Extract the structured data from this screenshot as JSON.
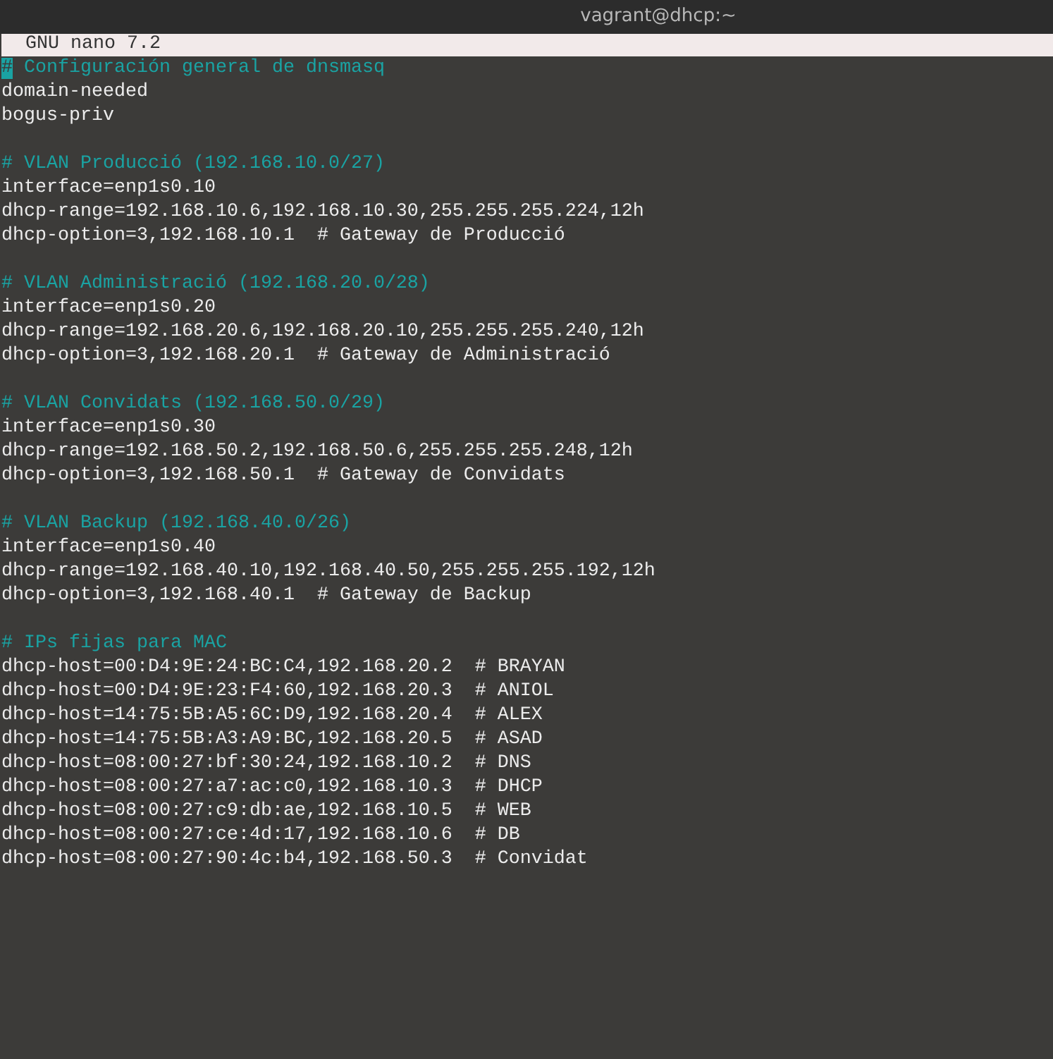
{
  "window": {
    "title": "vagrant@dhcp:~"
  },
  "editor": {
    "header": "GNU nano 7.2",
    "lines": [
      {
        "kind": "comment",
        "text": "# Configuración general de dnsmasq",
        "cursor": true
      },
      {
        "kind": "code",
        "text": "domain-needed",
        "cursor": false
      },
      {
        "kind": "code",
        "text": "bogus-priv",
        "cursor": false
      },
      {
        "kind": "blank",
        "cursor": false
      },
      {
        "kind": "comment",
        "text": "# VLAN Producció (192.168.10.0/27)",
        "cursor": false
      },
      {
        "kind": "code",
        "text": "interface=enp1s0.10",
        "cursor": false
      },
      {
        "kind": "code",
        "text": "dhcp-range=192.168.10.6,192.168.10.30,255.255.255.224,12h",
        "cursor": false
      },
      {
        "kind": "code",
        "text": "dhcp-option=3,192.168.10.1  # Gateway de Producció",
        "cursor": false
      },
      {
        "kind": "blank",
        "cursor": false
      },
      {
        "kind": "comment",
        "text": "# VLAN Administració (192.168.20.0/28)",
        "cursor": false
      },
      {
        "kind": "code",
        "text": "interface=enp1s0.20",
        "cursor": false
      },
      {
        "kind": "code",
        "text": "dhcp-range=192.168.20.6,192.168.20.10,255.255.255.240,12h",
        "cursor": false
      },
      {
        "kind": "code",
        "text": "dhcp-option=3,192.168.20.1  # Gateway de Administració",
        "cursor": false
      },
      {
        "kind": "blank",
        "cursor": false
      },
      {
        "kind": "comment",
        "text": "# VLAN Convidats (192.168.50.0/29)",
        "cursor": false
      },
      {
        "kind": "code",
        "text": "interface=enp1s0.30",
        "cursor": false
      },
      {
        "kind": "code",
        "text": "dhcp-range=192.168.50.2,192.168.50.6,255.255.255.248,12h",
        "cursor": false
      },
      {
        "kind": "code",
        "text": "dhcp-option=3,192.168.50.1  # Gateway de Convidats",
        "cursor": false
      },
      {
        "kind": "blank",
        "cursor": false
      },
      {
        "kind": "comment",
        "text": "# VLAN Backup (192.168.40.0/26)",
        "cursor": false
      },
      {
        "kind": "code",
        "text": "interface=enp1s0.40",
        "cursor": false
      },
      {
        "kind": "code",
        "text": "dhcp-range=192.168.40.10,192.168.40.50,255.255.255.192,12h",
        "cursor": false
      },
      {
        "kind": "code",
        "text": "dhcp-option=3,192.168.40.1  # Gateway de Backup",
        "cursor": false
      },
      {
        "kind": "blank",
        "cursor": false
      },
      {
        "kind": "comment",
        "text": "# IPs fijas para MAC",
        "cursor": false
      },
      {
        "kind": "code",
        "text": "dhcp-host=00:D4:9E:24:BC:C4,192.168.20.2  # BRAYAN",
        "cursor": false
      },
      {
        "kind": "code",
        "text": "dhcp-host=00:D4:9E:23:F4:60,192.168.20.3  # ANIOL",
        "cursor": false
      },
      {
        "kind": "code",
        "text": "dhcp-host=14:75:5B:A5:6C:D9,192.168.20.4  # ALEX",
        "cursor": false
      },
      {
        "kind": "code",
        "text": "dhcp-host=14:75:5B:A3:A9:BC,192.168.20.5  # ASAD",
        "cursor": false
      },
      {
        "kind": "code",
        "text": "dhcp-host=08:00:27:bf:30:24,192.168.10.2  # DNS",
        "cursor": false
      },
      {
        "kind": "code",
        "text": "dhcp-host=08:00:27:a7:ac:c0,192.168.10.3  # DHCP",
        "cursor": false
      },
      {
        "kind": "code",
        "text": "dhcp-host=08:00:27:c9:db:ae,192.168.10.5  # WEB",
        "cursor": false
      },
      {
        "kind": "code",
        "text": "dhcp-host=08:00:27:ce:4d:17,192.168.10.6  # DB",
        "cursor": false
      },
      {
        "kind": "code",
        "text": "dhcp-host=08:00:27:90:4c:b4,192.168.50.3  # Convidat",
        "cursor": false
      }
    ]
  }
}
